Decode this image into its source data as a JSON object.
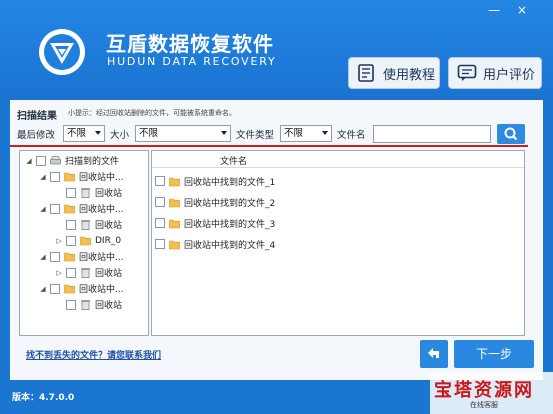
{
  "window": {
    "controls": [
      "—",
      "×"
    ]
  },
  "header": {
    "title": "互盾数据恢复软件",
    "subtitle": "HUDUN DATA RECOVERY",
    "tutorial_label": "使用教程",
    "review_label": "用户评价"
  },
  "scan": {
    "title": "扫描结果",
    "tip": "小提示：经过回收站删除的文件，可能被系统重命名。"
  },
  "filters": {
    "modified_label": "最后修改",
    "modified_value": "不限",
    "size_label": "大小",
    "size_value": "不限",
    "type_label": "文件类型",
    "type_value": "不限",
    "name_label": "文件名",
    "name_value": ""
  },
  "tree": {
    "root": "扫描到的文件",
    "items": [
      {
        "label": "回收站中...",
        "kind": "folder",
        "toggle": "◢"
      },
      {
        "label": "回收站",
        "kind": "bin",
        "toggle": ""
      },
      {
        "label": "回收站中...",
        "kind": "folder",
        "toggle": "◢"
      },
      {
        "label": "回收站",
        "kind": "bin",
        "toggle": ""
      },
      {
        "label": "DIR_0",
        "kind": "folder",
        "toggle": "▷"
      },
      {
        "label": "回收站中...",
        "kind": "folder",
        "toggle": "◢"
      },
      {
        "label": "回收站",
        "kind": "bin",
        "toggle": "▷"
      },
      {
        "label": "回收站中...",
        "kind": "folder",
        "toggle": "◢"
      },
      {
        "label": "回收站",
        "kind": "bin",
        "toggle": ""
      }
    ]
  },
  "files": {
    "header": "文件名",
    "rows": [
      "回收站中找到的文件_1",
      "回收站中找到的文件_2",
      "回收站中找到的文件_3",
      "回收站中找到的文件_4"
    ]
  },
  "footer": {
    "help_link": "找不到丢失的文件？请您联系我们",
    "next_label": "下一步",
    "version": "版本：4.7.0.0"
  },
  "watermark": {
    "text": "宝塔资源网",
    "sub": "在线客服"
  },
  "colors": {
    "primary": "#1b76d2",
    "accent_red": "#c6211f",
    "button": "#2a88e0"
  }
}
